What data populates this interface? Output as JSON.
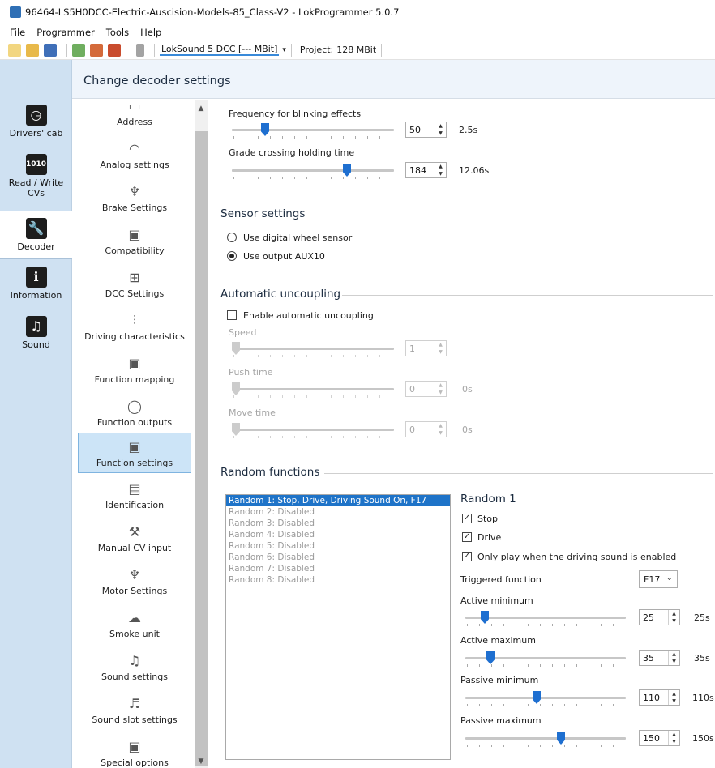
{
  "window": {
    "title": "96464-LS5H0DCC-Electric-Auscision-Models-85_Class-V2 - LokProgrammer 5.0.7"
  },
  "menu": [
    "File",
    "Programmer",
    "Tools",
    "Help"
  ],
  "toolbar": {
    "decoder_label": "LokSound 5 DCC [--- MBit]",
    "project_label": "Project:",
    "project_value": "128 MBit",
    "icons": [
      "new-icon",
      "open-icon",
      "save-icon",
      "read-icon",
      "write-icon",
      "run-icon",
      "tool-icon"
    ]
  },
  "sidebar": {
    "items": [
      {
        "label": "Drivers' cab",
        "icon": "drivers-cab-icon",
        "active": false
      },
      {
        "label": "Read / Write CVs",
        "icon": "read-write-cvs-icon",
        "active": false
      },
      {
        "label": "Decoder",
        "icon": "decoder-icon",
        "active": true
      },
      {
        "label": "Information",
        "icon": "information-icon",
        "active": false
      },
      {
        "label": "Sound",
        "icon": "sound-icon",
        "active": false
      }
    ]
  },
  "header": {
    "title": "Change decoder settings"
  },
  "categories": [
    {
      "label": "Address",
      "icon": "address-icon"
    },
    {
      "label": "Analog settings",
      "icon": "analog-settings-icon"
    },
    {
      "label": "Brake Settings",
      "icon": "brake-settings-icon"
    },
    {
      "label": "Compatibility",
      "icon": "compatibility-icon"
    },
    {
      "label": "DCC Settings",
      "icon": "dcc-settings-icon"
    },
    {
      "label": "Driving characteristics",
      "icon": "driving-characteristics-icon"
    },
    {
      "label": "Function mapping",
      "icon": "function-mapping-icon"
    },
    {
      "label": "Function outputs",
      "icon": "function-outputs-icon"
    },
    {
      "label": "Function settings",
      "icon": "function-settings-icon",
      "selected": true
    },
    {
      "label": "Identification",
      "icon": "identification-icon"
    },
    {
      "label": "Manual CV input",
      "icon": "manual-cv-input-icon"
    },
    {
      "label": "Motor Settings",
      "icon": "motor-settings-icon"
    },
    {
      "label": "Smoke unit",
      "icon": "smoke-unit-icon"
    },
    {
      "label": "Sound settings",
      "icon": "sound-settings-icon"
    },
    {
      "label": "Sound slot settings",
      "icon": "sound-slot-settings-icon"
    },
    {
      "label": "Special options",
      "icon": "special-options-icon"
    }
  ],
  "blinking": {
    "label": "Frequency for blinking effects",
    "value": "50",
    "unit": "2.5s",
    "level": 0.19
  },
  "grade_crossing": {
    "label": "Grade crossing holding time",
    "value": "184",
    "unit": "12.06s",
    "level": 0.72
  },
  "sensor": {
    "title": "Sensor settings",
    "option1": "Use digital wheel sensor",
    "option2": "Use output AUX10",
    "selected": "option2"
  },
  "uncoupling": {
    "title": "Automatic uncoupling",
    "enable_label": "Enable automatic uncoupling",
    "enabled": false,
    "speed_label": "Speed",
    "speed_value": "1",
    "push_label": "Push time",
    "push_value": "0",
    "push_unit": "0s",
    "move_label": "Move time",
    "move_value": "0",
    "move_unit": "0s"
  },
  "random": {
    "title": "Random functions",
    "list": [
      "Random 1: Stop, Drive, Driving Sound On, F17",
      "Random 2: Disabled",
      "Random 3: Disabled",
      "Random 4: Disabled",
      "Random 5: Disabled",
      "Random 6: Disabled",
      "Random 7: Disabled",
      "Random 8: Disabled"
    ],
    "selected_index": 0,
    "detail_title": "Random 1",
    "stop_label": "Stop",
    "drive_label": "Drive",
    "sound_only_label": "Only play when the driving sound is enabled",
    "triggered_label": "Triggered function",
    "triggered_value": "F17",
    "active_min": {
      "label": "Active minimum",
      "value": "25",
      "unit": "25s",
      "level": 0.1
    },
    "active_max": {
      "label": "Active maximum",
      "value": "35",
      "unit": "35s",
      "level": 0.14
    },
    "passive_min": {
      "label": "Passive minimum",
      "value": "110",
      "unit": "110s",
      "level": 0.44
    },
    "passive_max": {
      "label": "Passive maximum",
      "value": "150",
      "unit": "150s",
      "level": 0.6
    }
  },
  "colors": {
    "accent": "#1e6fd0",
    "sidebar_bg": "#cfe1f2",
    "selection": "#1e73c8"
  }
}
